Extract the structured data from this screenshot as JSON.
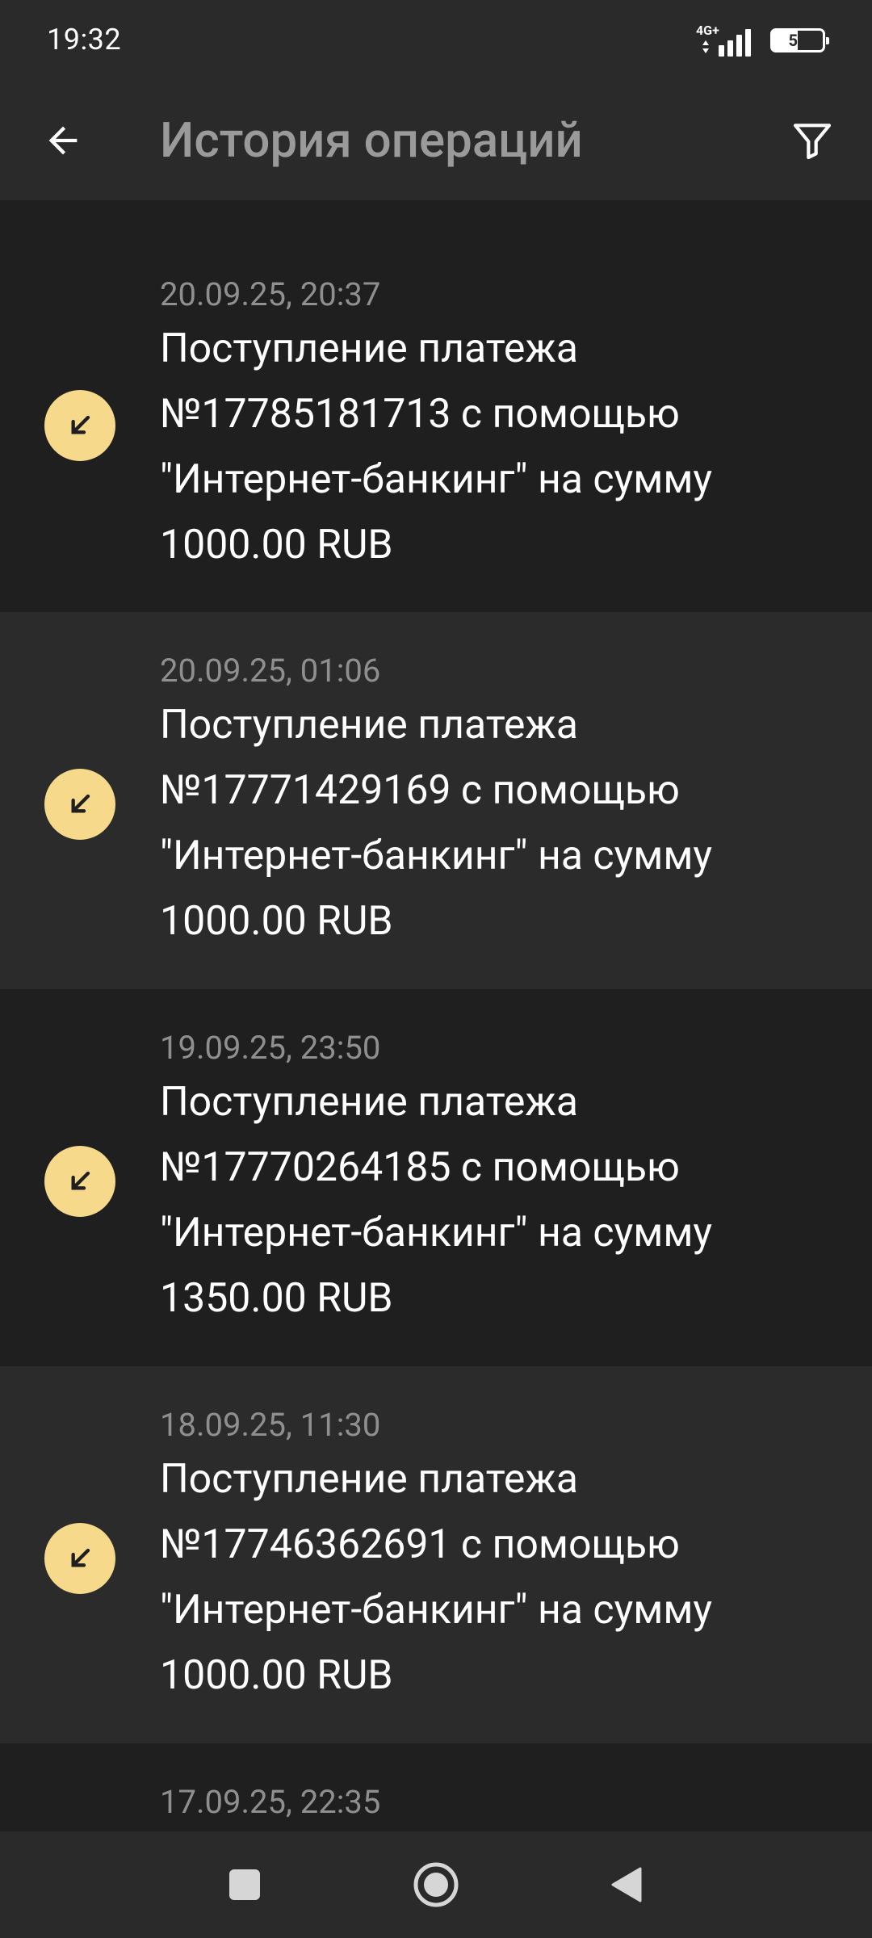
{
  "status_bar": {
    "time": "19:32",
    "network": "4G+",
    "battery": "50"
  },
  "app_bar": {
    "title": "История операций",
    "back_icon": "arrow-left-icon",
    "filter_icon": "filter-icon"
  },
  "transactions": [
    {
      "date": "20.09.25, 20:37",
      "description": "Поступление платежа\n№17785181713 с помощью\n\"Интернет-банкинг\" на сумму\n1000.00 RUB",
      "icon": "incoming-arrow-icon"
    },
    {
      "date": "20.09.25, 01:06",
      "description": "Поступление платежа\n№17771429169 с помощью\n\"Интернет-банкинг\" на сумму\n1000.00 RUB",
      "icon": "incoming-arrow-icon"
    },
    {
      "date": "19.09.25, 23:50",
      "description": "Поступление платежа\n№17770264185 с помощью\n\"Интернет-банкинг\" на сумму\n1350.00 RUB",
      "icon": "incoming-arrow-icon"
    },
    {
      "date": "18.09.25, 11:30",
      "description": "Поступление платежа\n№17746362691 с помощью\n\"Интернет-банкинг\" на сумму\n1000.00 RUB",
      "icon": "incoming-arrow-icon"
    },
    {
      "date": "17.09.25, 22:35"
    }
  ],
  "colors": {
    "background": "#212121",
    "row_dark": "#1f1f1f",
    "row_light": "#2b2b2b",
    "bar": "#2a2a2a",
    "accent_circle": "#f6d98a",
    "title_text": "#9a9a9a",
    "date_text": "#8f8f8f"
  },
  "nav_bar": {
    "recents_icon": "square-icon",
    "home_icon": "circle-home-icon",
    "back_icon": "triangle-back-icon"
  }
}
